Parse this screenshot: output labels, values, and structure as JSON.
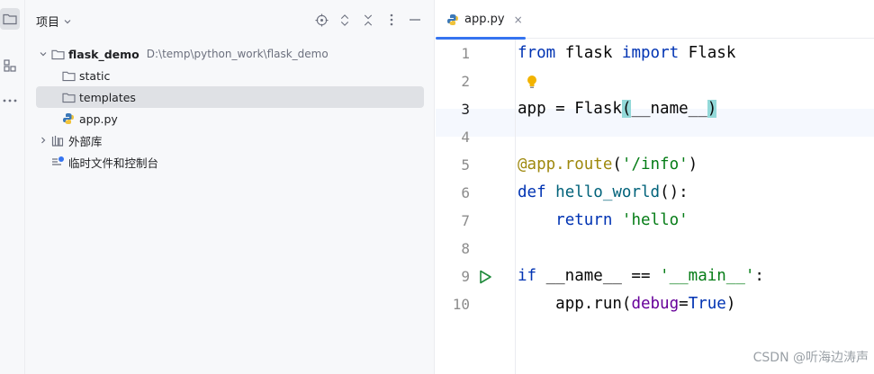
{
  "sidebar": {
    "tools": [
      {
        "icon": "folder-icon",
        "active": true
      },
      {
        "icon": "structure-icon",
        "active": false
      },
      {
        "icon": "more-icon",
        "active": false
      }
    ]
  },
  "project_panel": {
    "title": "项目",
    "header_icons": [
      "locate-icon",
      "expand-all-icon",
      "collapse-all-icon",
      "options-icon",
      "minimize-icon"
    ],
    "tree": [
      {
        "label": "flask_demo",
        "path": "D:\\temp\\python_work\\flask_demo",
        "type": "folder",
        "expanded": true
      },
      {
        "label": "static",
        "type": "folder"
      },
      {
        "label": "templates",
        "type": "folder",
        "selected": true
      },
      {
        "label": "app.py",
        "type": "python-file"
      },
      {
        "label": "外部库",
        "type": "library",
        "expanded": false
      },
      {
        "label": "临时文件和控制台",
        "type": "scratches"
      }
    ]
  },
  "editor": {
    "tab": {
      "label": "app.py",
      "close": "×"
    },
    "line_numbers": [
      "1",
      "2",
      "3",
      "4",
      "5",
      "6",
      "7",
      "8",
      "9",
      "10"
    ],
    "current_line": "3",
    "code": {
      "l1": {
        "kw1": "from",
        "t1": " flask ",
        "kw2": "import",
        "t2": " Flask"
      },
      "l3": {
        "t1": "app = Flask",
        "p1": "(",
        "t2": "__name__",
        "p2": ")"
      },
      "l5": {
        "dec": "@app.route",
        "t1": "(",
        "str": "'/info'",
        "t2": ")"
      },
      "l6": {
        "kw": "def",
        "sp": " ",
        "fn": "hello_world",
        "t1": "():"
      },
      "l7": {
        "indent": "    ",
        "kw": "return",
        "sp": " ",
        "str": "'hello'"
      },
      "l9": {
        "kw": "if",
        "t1": " __name__ == ",
        "str": "'__main__'",
        "t2": ":"
      },
      "l10": {
        "indent": "    ",
        "t1": "app.run(",
        "arg": "debug",
        "t2": "=",
        "kw": "True",
        "t3": ")"
      }
    }
  },
  "watermark": "CSDN @听海边涛声",
  "colors": {
    "keyword": "#0033b3",
    "string": "#067d17",
    "decorator": "#9e880d",
    "function": "#00627a",
    "accent": "#3574f0",
    "run_icon": "#208a3c"
  }
}
